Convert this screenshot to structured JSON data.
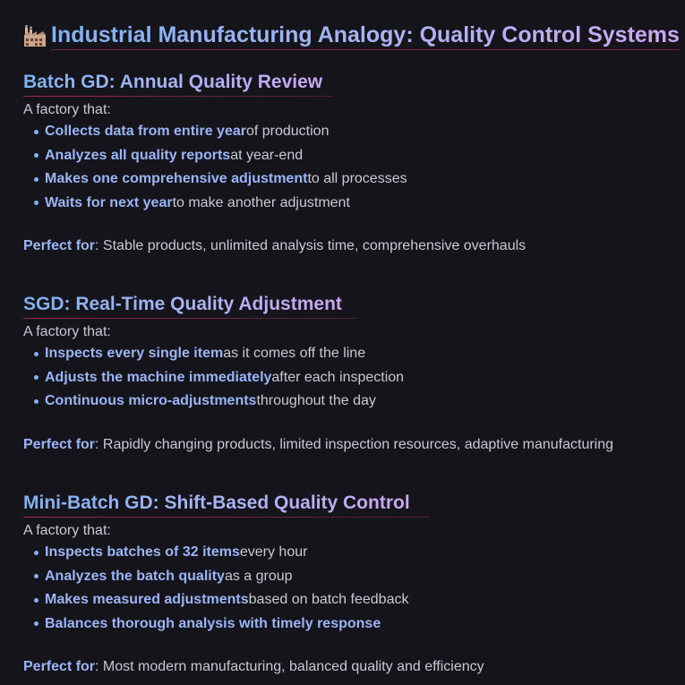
{
  "title": {
    "icon": "factory-icon",
    "text": "Industrial Manufacturing Analogy: Quality Control Systems"
  },
  "sections": [
    {
      "heading": "Batch GD: Annual Quality Review",
      "intro": "A factory that:",
      "bullets": [
        {
          "strong": "Collects data from entire year",
          "rest": " of production"
        },
        {
          "strong": "Analyzes all quality reports",
          "rest": " at year-end"
        },
        {
          "strong": "Makes one comprehensive adjustment",
          "rest": " to all processes"
        },
        {
          "strong": "Waits for next year",
          "rest": " to make another adjustment"
        }
      ],
      "perfect_label": "Perfect for",
      "perfect_text": ": Stable products, unlimited analysis time, comprehensive overhauls"
    },
    {
      "heading": "SGD: Real-Time Quality Adjustment",
      "intro": "A factory that:",
      "bullets": [
        {
          "strong": "Inspects every single item",
          "rest": " as it comes off the line"
        },
        {
          "strong": "Adjusts the machine immediately",
          "rest": " after each inspection"
        },
        {
          "strong": "Continuous micro-adjustments",
          "rest": " throughout the day"
        }
      ],
      "perfect_label": "Perfect for",
      "perfect_text": ": Rapidly changing products, limited inspection resources, adaptive manufacturing"
    },
    {
      "heading": "Mini-Batch GD: Shift-Based Quality Control",
      "intro": "A factory that:",
      "bullets": [
        {
          "strong": "Inspects batches of 32 items",
          "rest": " every hour"
        },
        {
          "strong": "Analyzes the batch quality",
          "rest": " as a group"
        },
        {
          "strong": "Makes measured adjustments",
          "rest": " based on batch feedback"
        },
        {
          "strong": "Balances thorough analysis with timely response",
          "rest": ""
        }
      ],
      "perfect_label": "Perfect for",
      "perfect_text": ": Most modern manufacturing, balanced quality and efficiency"
    }
  ],
  "colors": {
    "background": "#15141b",
    "gradient_start": "#7fb2f0",
    "gradient_end": "#cda6f3",
    "bold_text": "#9ab5f6",
    "body_text": "#c9c9d1",
    "underline": "#dc325a"
  }
}
